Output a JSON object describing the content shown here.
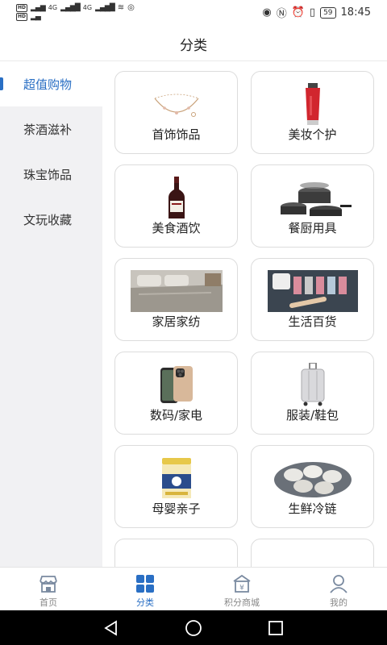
{
  "status_bar": {
    "hd_label": "HD",
    "net_left": "4G",
    "net_mid": "4G",
    "battery": "59",
    "time": "18:45"
  },
  "header": {
    "title": "分类"
  },
  "sidebar": {
    "items": [
      {
        "label": "超值购物"
      },
      {
        "label": "茶酒滋补"
      },
      {
        "label": "珠宝饰品"
      },
      {
        "label": "文玩收藏"
      }
    ]
  },
  "grid": {
    "items": [
      {
        "label": "首饰饰品",
        "icon": "bracelet-icon"
      },
      {
        "label": "美妆个护",
        "icon": "lipstick-tube-icon"
      },
      {
        "label": "美食酒饮",
        "icon": "wine-bottle-icon"
      },
      {
        "label": "餐厨用具",
        "icon": "cookware-icon"
      },
      {
        "label": "家居家纺",
        "icon": "bedding-icon"
      },
      {
        "label": "生活百货",
        "icon": "toothbrush-holder-icon"
      },
      {
        "label": "数码/家电",
        "icon": "phone-icon"
      },
      {
        "label": "服装/鞋包",
        "icon": "suitcase-icon"
      },
      {
        "label": "母婴亲子",
        "icon": "milk-powder-icon"
      },
      {
        "label": "生鲜冷链",
        "icon": "seafood-icon"
      },
      {
        "label": "",
        "icon": "tea-jar-icon"
      },
      {
        "label": "",
        "icon": "gift-box-icon"
      }
    ]
  },
  "bottom_nav": {
    "items": [
      {
        "label": "首页",
        "icon": "store-icon"
      },
      {
        "label": "分类",
        "icon": "grid-icon"
      },
      {
        "label": "积分商城",
        "icon": "points-mall-icon"
      },
      {
        "label": "我的",
        "icon": "person-icon"
      }
    ]
  },
  "colors": {
    "accent": "#2a6fc4",
    "sidebar_bg": "#f1f1f3",
    "card_border": "#dcdcdc"
  }
}
